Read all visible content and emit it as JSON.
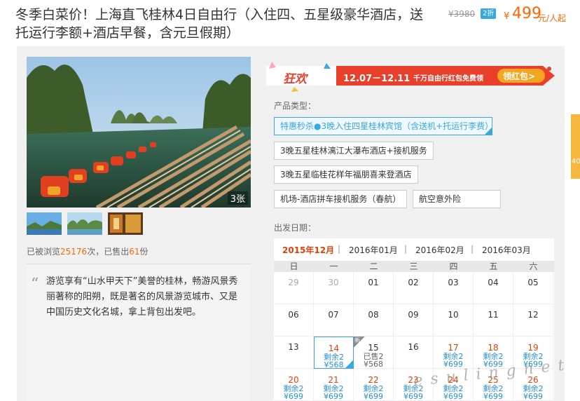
{
  "header": {
    "title": "冬季白菜价！上海直飞桂林4日自由行（入住四、五星级豪华酒店，送托运行李额+酒店早餐，含元旦假期）",
    "old_price": "¥3980",
    "discount_badge": "2折",
    "price_symbol": "¥",
    "price": "499",
    "price_unit": "元/人起"
  },
  "gallery": {
    "photo_count": "3张",
    "thumbs": [
      "thumb-1",
      "thumb-2",
      "thumb-3"
    ]
  },
  "stats": {
    "prefix": "已被浏览",
    "views": "25176",
    "middle": "次，已售出",
    "sold": "61",
    "suffix": "份"
  },
  "description": {
    "text": "游览享有“山水甲天下”美誉的桂林，畅游风景秀丽著称的阳朔，既是著名的风景游览城市、又是中国历史文化名城，拿上背包出发吧。"
  },
  "banner": {
    "brand": "狂欢",
    "dates": "12.07－12.11",
    "text": "千万自由行红包免费领",
    "button": "领红包>"
  },
  "product": {
    "label": "产品类型：",
    "options": [
      "特惠秒杀●3晚入住四星桂林宾馆（含送机+托运行李费）",
      "3晚五星桂林漓江大瀑布酒店+接机服务",
      "3晚五星临桂花样年福朋喜来登酒店",
      "机场-酒店拼车接机服务（春航）",
      "航空意外险"
    ]
  },
  "departure": {
    "label": "出发日期："
  },
  "calendar": {
    "months": [
      "2015年12月",
      "2016年01月",
      "2016年02月",
      "2016年03月"
    ],
    "weekdays": [
      "日",
      "一",
      "二",
      "三",
      "四",
      "五",
      "六"
    ],
    "row1": [
      "29",
      "30",
      "01",
      "02",
      "03",
      "04",
      "05"
    ],
    "row2": [
      "06",
      "07",
      "08",
      "09",
      "10",
      "11",
      "12"
    ],
    "row3": {
      "d13": "13",
      "d14": "14",
      "d14_s": "剩余2",
      "d14_p": "¥568",
      "d15": "15",
      "d15_s": "已售2",
      "d15_p": "¥568",
      "d15_corner": "新",
      "d16": "16",
      "d17": "17",
      "d17_s": "剩余2",
      "d17_p": "¥699",
      "d18": "18",
      "d18_s": "剩余2",
      "d18_p": "¥699",
      "d19": "19",
      "d19_s": "剩余2",
      "d19_p": "¥699"
    },
    "row4": {
      "d20": "20",
      "d20_s": "剩余2",
      "d20_p": "¥699",
      "d21": "21",
      "d21_s": "剩余2",
      "d21_p": "¥699",
      "d22": "22",
      "d22_s": "剩余2",
      "d22_p": "¥699",
      "d23": "23",
      "d23_s": "剩余2",
      "d23_p": "¥699",
      "d24": "24",
      "d24_s": "剩余2",
      "d24_p": "¥699",
      "d25": "25",
      "d25_s": "剩余2",
      "d25_p": "¥699",
      "d26": "26",
      "d26_s": "剩余2",
      "d26_p": "¥699"
    }
  },
  "side_tab": {
    "text": "40"
  },
  "watermark": {
    "text": "e s u l i n g n e t"
  },
  "colors": {
    "accent": "#3aa8e0",
    "price": "#ff6600",
    "active_month": "#e0400a",
    "banner_red": "#e8402a"
  }
}
